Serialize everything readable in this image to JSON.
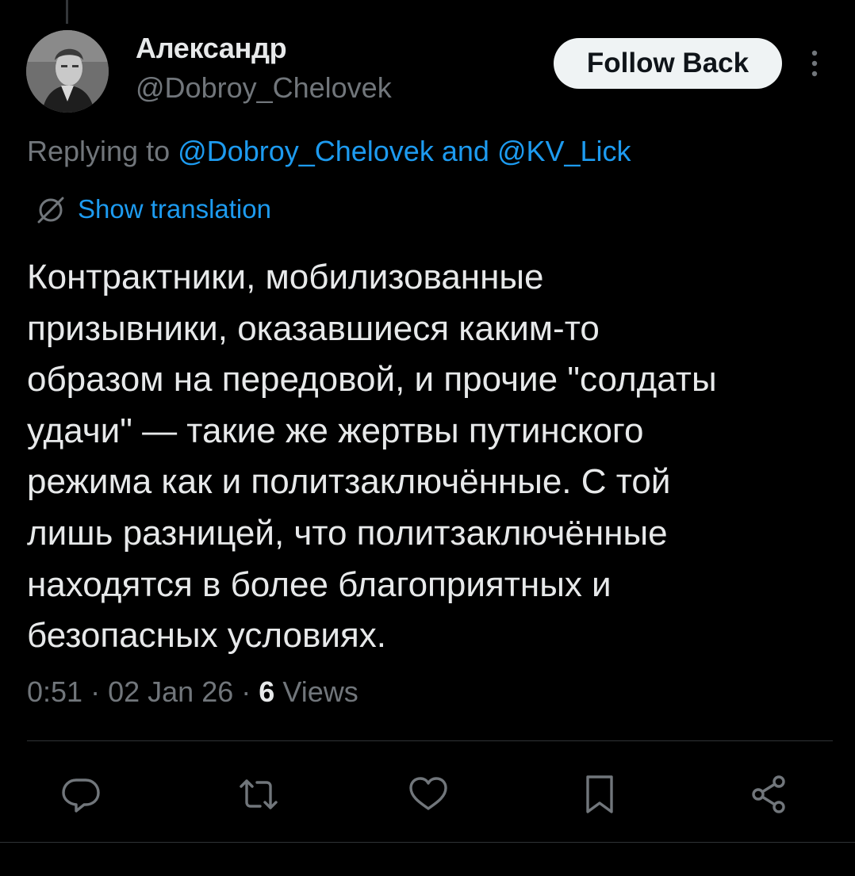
{
  "author": {
    "name": "Александр",
    "handle": "@Dobroy_Chelovek",
    "avatar": "avatar"
  },
  "header": {
    "follow_label": "Follow Back",
    "more_icon": "more-vertical-icon"
  },
  "reply": {
    "prefix": "Replying to",
    "mention1": "@Dobroy_Chelovek",
    "connector": "and",
    "mention2": "@KV_Lick"
  },
  "translate": {
    "label": "Show translation",
    "icon": "translate-icon"
  },
  "tweet": {
    "lines": [
      "Контрактники, мобилизованные",
      "призывники, оказавшиеся каким-то",
      "образом на передовой, и прочие \"солдаты",
      "удачи\" — такие же жертвы путинского",
      "режима как и политзаключённые. С той",
      "лишь разницей, что политзаключённые",
      "находятся в более благоприятных и",
      "безопасных условиях."
    ]
  },
  "meta": {
    "time": "0:51",
    "date": "02 Jan 26",
    "views_count": "6",
    "views_label": "Views",
    "separator": "·"
  },
  "actions": [
    {
      "icon": "reply-icon"
    },
    {
      "icon": "retweet-icon"
    },
    {
      "icon": "like-icon"
    },
    {
      "icon": "bookmark-icon"
    },
    {
      "icon": "share-icon"
    }
  ],
  "colors": {
    "background": "#000000",
    "text": "#e7e9ea",
    "muted": "#71767b",
    "accent": "#1d9bf0",
    "button_bg": "#eff3f4",
    "button_text": "#0f1419",
    "divider": "#2f3336"
  }
}
